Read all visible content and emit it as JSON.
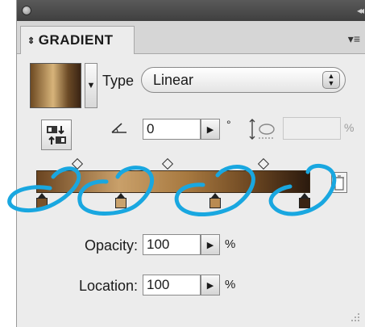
{
  "panel": {
    "tab_label": "GRADIENT",
    "tab_arrows": "⇕",
    "menu_icon": "▾≡",
    "collapse_icon": "◂◂"
  },
  "type": {
    "label": "Type",
    "selected": "Linear"
  },
  "angle": {
    "value": "0",
    "unit": "°"
  },
  "aspect_ratio": {
    "value": "",
    "unit": "%"
  },
  "ramp": {
    "stops": [
      {
        "location": 0,
        "color": "#7a5229"
      },
      {
        "location": 30,
        "color": "#c9a26d"
      },
      {
        "location": 66,
        "color": "#b98b52"
      },
      {
        "location": 100,
        "color": "#3a2414"
      }
    ],
    "midpoints": [
      15,
      48,
      83
    ]
  },
  "opacity": {
    "label": "Opacity:",
    "value": "100",
    "unit": "%"
  },
  "location": {
    "label": "Location:",
    "value": "100",
    "unit": "%"
  },
  "colors": {
    "annotation": "#19a7e0",
    "panel_bg": "#ececec"
  }
}
